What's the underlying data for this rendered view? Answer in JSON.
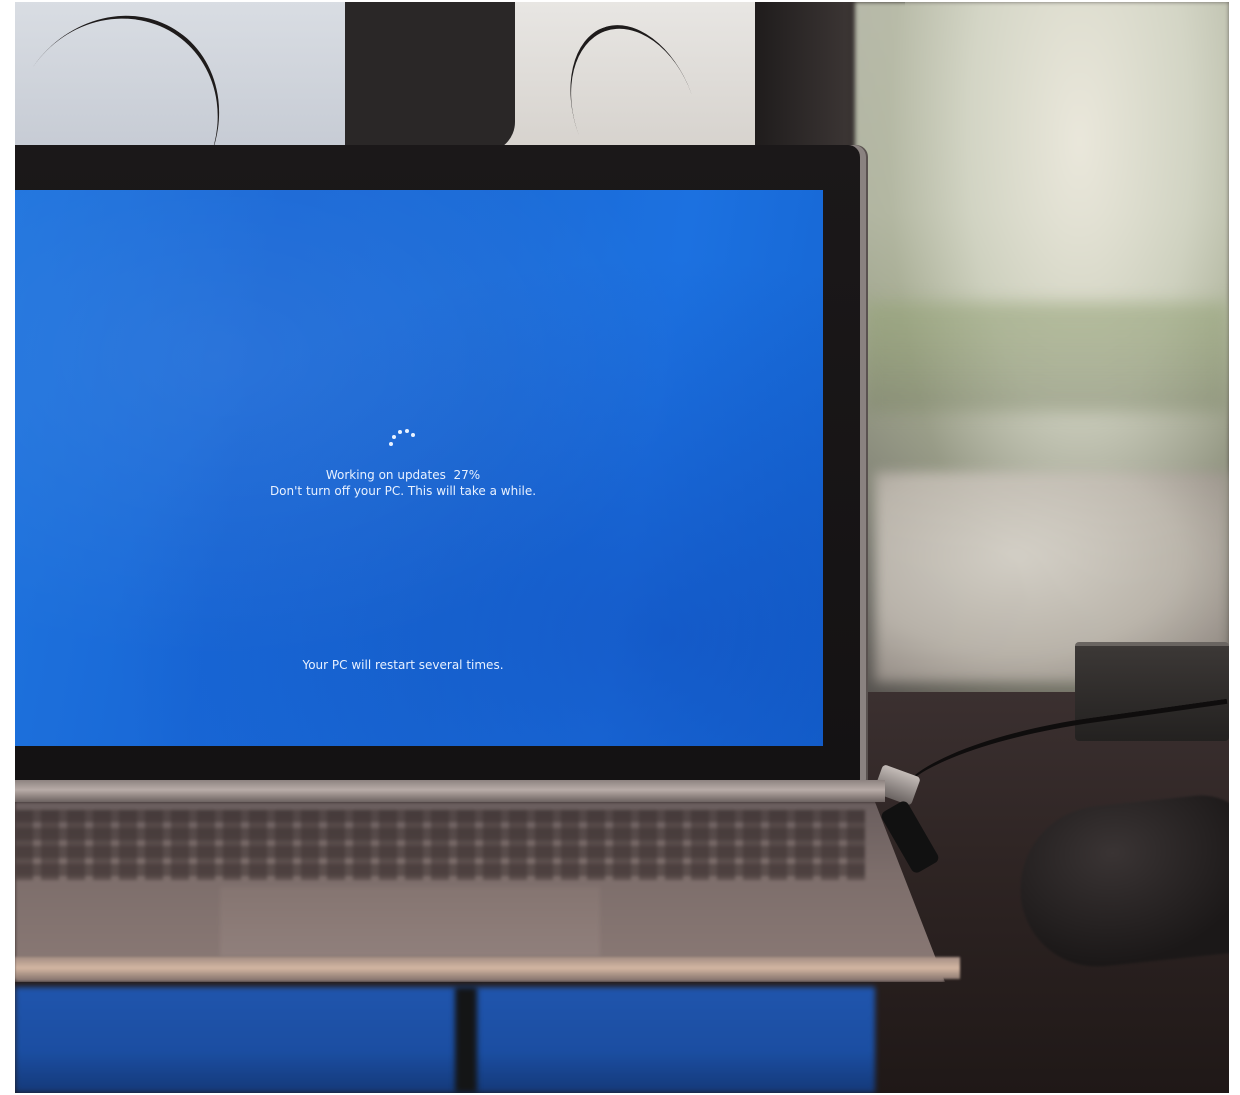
{
  "screen": {
    "status_line": "Working on updates  27%",
    "warning_line": "Don't turn off your PC. This will take a while.",
    "restart_notice": "Your PC will restart several times.",
    "progress_percent": 27,
    "background_color": "#1a6bd8",
    "text_color": "#e8f1ff"
  },
  "icons": {
    "spinner": "loading-spinner-icon"
  }
}
